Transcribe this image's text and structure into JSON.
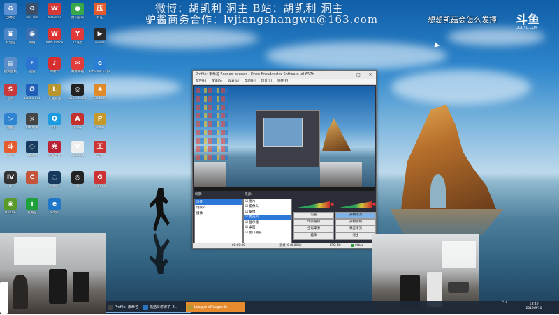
{
  "overlay": {
    "line1": "微博：胡凯利 洞主 B站：胡凯利 洞主",
    "line2": "驴酱商务合作：lvjiangshangwu@163.com",
    "side_text": "想想凯菇会怎么发揮"
  },
  "logo": {
    "mark": "斗鱼",
    "sub": "DOUYU.COM"
  },
  "desktop_icons": [
    {
      "label": "回收站",
      "color": "#5a8fd0",
      "glyph": "♻",
      "icon": "recycle-bin-icon"
    },
    {
      "label": "TCP Test",
      "color": "#3b4f6b",
      "glyph": "⚙",
      "icon": "app-icon"
    },
    {
      "label": "WeGame",
      "color": "#d53a3a",
      "glyph": "W",
      "icon": "wegame-icon"
    },
    {
      "label": "腾讯管家",
      "color": "#39a84a",
      "glyph": "●",
      "icon": "shield-icon"
    },
    {
      "label": "好压",
      "color": "#e55c2e",
      "glyph": "压",
      "icon": "archive-icon"
    },
    {
      "label": "此电脑",
      "color": "#4a86c5",
      "glyph": "▣",
      "icon": "computer-icon"
    },
    {
      "label": "网络",
      "color": "#3a70b0",
      "glyph": "◉",
      "icon": "network-icon"
    },
    {
      "label": "WPS Office",
      "color": "#d33",
      "glyph": "W",
      "icon": "wps-icon"
    },
    {
      "label": "YY语音",
      "color": "#e23a3a",
      "glyph": "Y",
      "icon": "yy-icon"
    },
    {
      "label": "nvidia",
      "color": "#2a2a2a",
      "glyph": "▶",
      "icon": "nvidia-icon"
    },
    {
      "label": "控制面板",
      "color": "#5b8ec9",
      "glyph": "▤",
      "icon": "control-panel-icon"
    },
    {
      "label": "迅雷",
      "color": "#2b74cf",
      "glyph": "⚡",
      "icon": "thunder-icon"
    },
    {
      "label": "网易云",
      "color": "#d72f2f",
      "glyph": "♪",
      "icon": "music-icon"
    },
    {
      "label": "网易邮箱",
      "color": "#e23b3b",
      "glyph": "✉",
      "icon": "mail-icon"
    },
    {
      "label": "Internet Explorer",
      "color": "#2a7fd4",
      "glyph": "e",
      "icon": "ie-icon"
    },
    {
      "label": "搜狗",
      "color": "#c83a3a",
      "glyph": "S",
      "icon": "sogou-icon"
    },
    {
      "label": "Battle.net",
      "color": "#1f5fb5",
      "glyph": "✪",
      "icon": "battlenet-icon"
    },
    {
      "label": "英雄联盟",
      "color": "#b8962f",
      "glyph": "L",
      "icon": "lol-icon"
    },
    {
      "label": "OBS Studio",
      "color": "#222",
      "glyph": "◎",
      "icon": "obs-icon"
    },
    {
      "label": "Solitaire",
      "color": "#e08a2a",
      "glyph": "♠",
      "icon": "game-icon"
    },
    {
      "label": "优酷",
      "color": "#2f84d1",
      "glyph": "▷",
      "icon": "video-icon"
    },
    {
      "label": "LOL助手",
      "color": "#444",
      "glyph": "⚔",
      "icon": "game-icon"
    },
    {
      "label": "QQ",
      "color": "#1d9be0",
      "glyph": "Q",
      "icon": "qq-icon"
    },
    {
      "label": "Apex",
      "color": "#c4302b",
      "glyph": "A",
      "icon": "apex-icon"
    },
    {
      "label": "PUBG",
      "color": "#c69a2a",
      "glyph": "P",
      "icon": "pubg-icon"
    },
    {
      "label": "斗鱼",
      "color": "#e55c2e",
      "glyph": "斗",
      "icon": "douyu-icon"
    },
    {
      "label": "Steam",
      "color": "#173a5e",
      "glyph": "◌",
      "icon": "steam-icon"
    },
    {
      "label": "完美世界",
      "color": "#b23",
      "glyph": "完",
      "icon": "game-icon"
    },
    {
      "label": "Valorant",
      "color": "#eee",
      "glyph": "V",
      "icon": "valorant-icon"
    },
    {
      "label": "王者",
      "color": "#c33",
      "glyph": "王",
      "icon": "game-icon"
    },
    {
      "label": "IV",
      "color": "#333",
      "glyph": "IV",
      "icon": "game-icon"
    },
    {
      "label": "CF",
      "color": "#c5553a",
      "glyph": "C",
      "icon": "game-icon"
    },
    {
      "label": "Steam",
      "color": "#173a5e",
      "glyph": "◌",
      "icon": "steam-icon"
    },
    {
      "label": "OBS",
      "color": "#222",
      "glyph": "◎",
      "icon": "obs-icon"
    },
    {
      "label": "Garena",
      "color": "#c33",
      "glyph": "G",
      "icon": "game-icon"
    },
    {
      "label": "NVIDIA",
      "color": "#5a9a2a",
      "glyph": "◉",
      "icon": "nvidia-icon"
    },
    {
      "label": "爱奇艺",
      "color": "#1ea03a",
      "glyph": "i",
      "icon": "video-icon"
    },
    {
      "label": "Edge",
      "color": "#1f77c9",
      "glyph": "e",
      "icon": "edge-icon"
    }
  ],
  "obs": {
    "title": "Profile: 未命名  Scenes: scenes - Open Broadcaster Software v0.657b",
    "menu": [
      "文件(F)",
      "配置(S)",
      "设置(E)",
      "帮助(H)",
      "场景(S)",
      "插件(P)"
    ],
    "dock": {
      "scenes": "场景:",
      "sources": "来源:"
    },
    "scenes": [
      "场景",
      "场景2",
      "摄像"
    ],
    "sources": [
      "图片",
      "摄像头",
      "摄像",
      "麦克风",
      "显示器",
      "桌面",
      "窗口捕获"
    ],
    "buttons": [
      "设置",
      "开始串流",
      "场景编辑",
      "开始录制",
      "全局来源",
      "预览串流",
      "插件",
      "退出"
    ],
    "status": {
      "time": "00:00:00",
      "drop": "丢帧: 0 (0.00%)",
      "fps": "FPS: 60",
      "bitrate": "0kb/s"
    }
  },
  "taskbar": {
    "items": [
      {
        "label": "Profile: 未命名",
        "color": "#444"
      },
      {
        "label": "凯菇哥讲课了_2...",
        "color": "#2a74c4"
      },
      {
        "label": "League of Legends",
        "color": "#b8962f"
      }
    ],
    "clock": {
      "time": "13:40",
      "date": "2019/9/10"
    }
  }
}
